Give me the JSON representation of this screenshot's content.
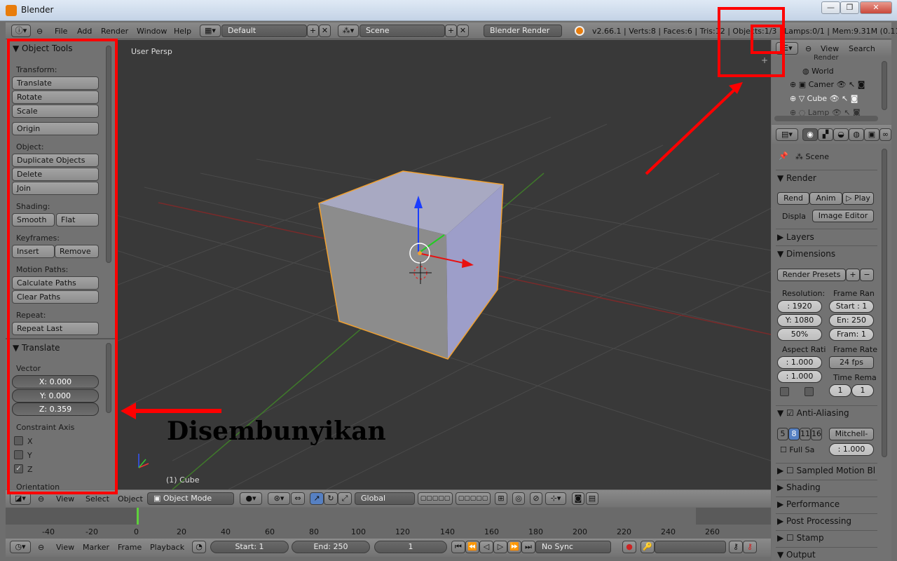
{
  "window": {
    "title": "Blender",
    "min": "—",
    "max": "❐",
    "close": "✕"
  },
  "info_header": {
    "menus": [
      "File",
      "Add",
      "Render",
      "Window",
      "Help"
    ],
    "layout": "Default",
    "scene": "Scene",
    "engine": "Blender Render",
    "stats": "v2.66.1 | Verts:8 | Faces:6 | Tris:12 | Objects:1/3 | Lamps:0/1 | Mem:9.31M (0.11M)"
  },
  "toolshelf": {
    "title": "Object Tools",
    "transform_label": "Transform:",
    "translate": "Translate",
    "rotate": "Rotate",
    "scale": "Scale",
    "origin": "Origin",
    "object_label": "Object:",
    "duplicate": "Duplicate Objects",
    "delete": "Delete",
    "join": "Join",
    "shading_label": "Shading:",
    "smooth": "Smooth",
    "flat": "Flat",
    "keyframes_label": "Keyframes:",
    "insert": "Insert",
    "remove": "Remove",
    "motion_label": "Motion Paths:",
    "calc_paths": "Calculate Paths",
    "clear_paths": "Clear Paths",
    "repeat_label": "Repeat:",
    "repeat_last": "Repeat Last",
    "op_title": "Translate",
    "vector_label": "Vector",
    "x": "X: 0.000",
    "y": "Y: 0.000",
    "z": "Z: 0.359",
    "constraint_label": "Constraint Axis",
    "cx": "X",
    "cy": "Y",
    "cz": "Z",
    "orientation_label": "Orientation"
  },
  "viewport": {
    "persp": "User Persp",
    "object": "(1) Cube"
  },
  "annotation": {
    "text": "Disembunyikan"
  },
  "outliner": {
    "view": "View",
    "search": "Search",
    "items": [
      "Render",
      "World",
      "Camer",
      "Cube",
      "Lamp"
    ]
  },
  "properties": {
    "scene": "Scene",
    "render_panel": "Render",
    "render_btn": "Rend",
    "anim_btn": "Anim",
    "play_btn": "Play",
    "display_label": "Displa",
    "display_value": "Image Editor",
    "layers_panel": "Layers",
    "dimensions_panel": "Dimensions",
    "render_presets": "Render Presets",
    "resolution_label": "Resolution:",
    "frame_range_label": "Frame Ran",
    "res_x": ": 1920",
    "res_y": "Y: 1080",
    "res_pct": "50%",
    "start": "Start : 1",
    "end": "En: 250",
    "frame": "Fram: 1",
    "aspect_label": "Aspect Rati",
    "frame_rate_label": "Frame Rate",
    "aspect_x": ": 1.000",
    "aspect_y": ": 1.000",
    "fps": "24 fps",
    "time_remap_label": "Time Rema",
    "remap_old": "1",
    "remap_new": "1",
    "aa_panel": "Anti-Aliasing",
    "aa_samples": [
      "5",
      "8",
      "11",
      "16"
    ],
    "aa_filter": "Mitchell-",
    "full_sample": "Full Sa",
    "filter_size": ": 1.000",
    "motion_blur_panel": "Sampled Motion Bl",
    "shading_panel": "Shading",
    "performance_panel": "Performance",
    "post_panel": "Post Processing",
    "stamp_panel": "Stamp",
    "output_panel": "Output"
  },
  "v3d_header": {
    "view": "View",
    "select": "Select",
    "object": "Object",
    "mode": "Object Mode",
    "orientation": "Global"
  },
  "timeline": {
    "ticks": [
      "-40",
      "-20",
      "0",
      "20",
      "40",
      "60",
      "80",
      "100",
      "120",
      "140",
      "160",
      "180",
      "200",
      "220",
      "240",
      "260"
    ],
    "current_frame": 1
  },
  "timeline_header": {
    "view": "View",
    "marker": "Marker",
    "frame": "Frame",
    "playback": "Playback",
    "start": "Start: 1",
    "end": "End: 250",
    "current": "1",
    "sync": "No Sync"
  }
}
